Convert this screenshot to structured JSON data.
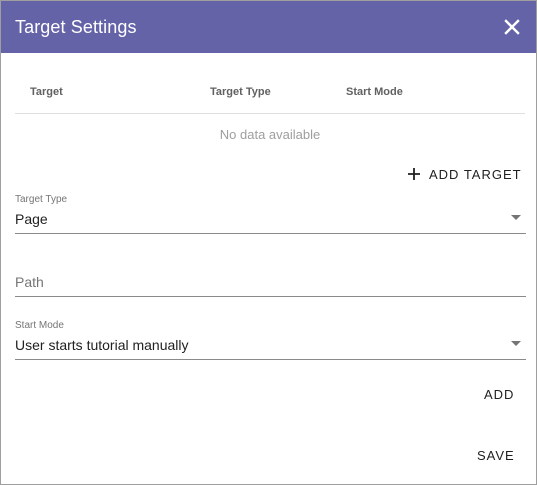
{
  "dialog": {
    "title": "Target Settings",
    "header_color": "#6563a8"
  },
  "table": {
    "columns": [
      "Target",
      "Target Type",
      "Start Mode"
    ],
    "empty_text": "No data available"
  },
  "actions": {
    "add_target_label": "ADD TARGET",
    "add_label": "ADD",
    "save_label": "SAVE"
  },
  "form": {
    "target_type": {
      "label": "Target Type",
      "value": "Page"
    },
    "path": {
      "placeholder": "Path"
    },
    "start_mode": {
      "label": "Start Mode",
      "value": "User starts tutorial manually"
    }
  },
  "icons": {
    "close": "close-icon",
    "add": "plus-icon",
    "dropdown": "caret-down-icon"
  }
}
